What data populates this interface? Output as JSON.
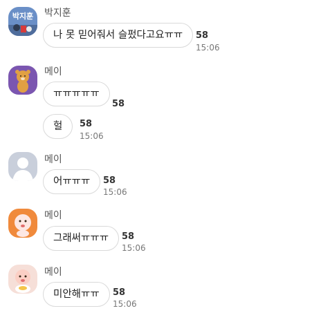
{
  "messages": [
    {
      "sender": "박지훈",
      "avatar_text": "박지훈",
      "avatar_color": "#6a8fc7",
      "bubbles": [
        {
          "text": "나 못 믿어줘서 슬펐다고요ㅠㅠ",
          "unread": "58",
          "time": "15:06"
        }
      ]
    },
    {
      "sender": "메이",
      "avatar_color": "#7b56b0",
      "bubbles": [
        {
          "text": "ㅠㅠㅠㅠㅠ",
          "unread": "58",
          "time": ""
        },
        {
          "text": "헐",
          "unread": "58",
          "time": "15:06"
        }
      ]
    },
    {
      "sender": "메이",
      "avatar_color": "#c9cfdb",
      "bubbles": [
        {
          "text": "어ㅠㅠㅠ",
          "unread": "58",
          "time": "15:06"
        }
      ]
    },
    {
      "sender": "메이",
      "avatar_color": "#f08a3c",
      "bubbles": [
        {
          "text": "그래써ㅠㅠㅠ",
          "unread": "58",
          "time": "15:06"
        }
      ]
    },
    {
      "sender": "메이",
      "avatar_color": "#f6dfd8",
      "bubbles": [
        {
          "text": "미안해ㅠㅠ",
          "unread": "58",
          "time": "15:06"
        }
      ]
    }
  ]
}
